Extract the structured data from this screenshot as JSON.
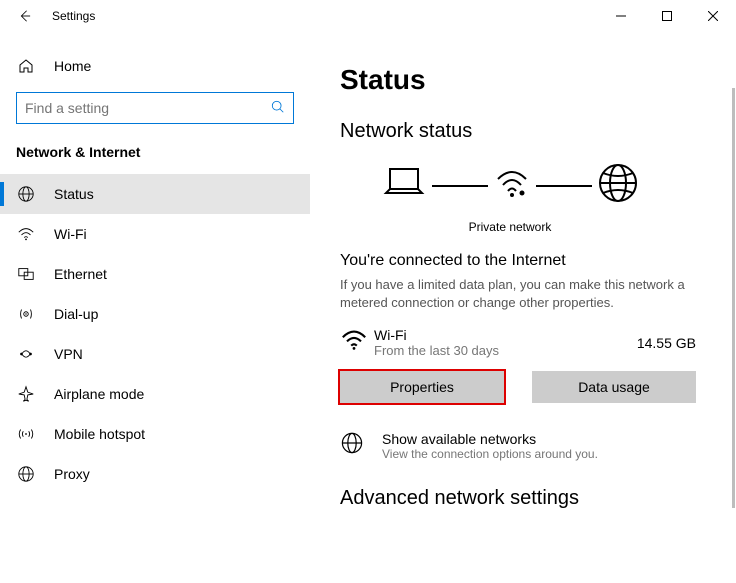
{
  "titlebar": {
    "title": "Settings"
  },
  "sidebar": {
    "home": "Home",
    "search_placeholder": "Find a setting",
    "group": "Network & Internet",
    "items": [
      "Status",
      "Wi-Fi",
      "Ethernet",
      "Dial-up",
      "VPN",
      "Airplane mode",
      "Mobile hotspot",
      "Proxy"
    ]
  },
  "main": {
    "title": "Status",
    "network_status": "Network status",
    "diagram_caption": "Private network",
    "connected_title": "You're connected to the Internet",
    "connected_desc": "If you have a limited data plan, you can make this network a metered connection or change other properties.",
    "wifi_name": "Wi-Fi",
    "wifi_sub": "From the last 30 days",
    "wifi_usage": "14.55 GB",
    "properties_btn": "Properties",
    "data_usage_btn": "Data usage",
    "available_title": "Show available networks",
    "available_sub": "View the connection options around you.",
    "advanced": "Advanced network settings"
  }
}
